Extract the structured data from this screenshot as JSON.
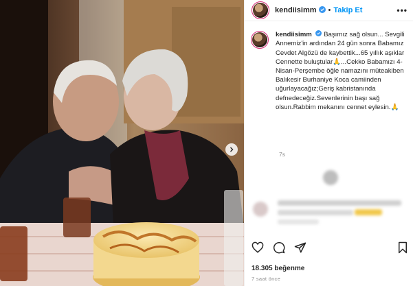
{
  "post": {
    "username": "kendiisimm",
    "follow_label": "Takip Et",
    "more_label": "•••",
    "caption": "Başımız sağ olsun... Sevgili Annemiz'in ardından 24 gün sonra Babamız Cevdet Algözü de kaybettik...65 yıllık aşıklar Cennette buluştular🙏...Cekko Babamızı 4-Nisan-Perşembe öğle namazını müteakiben Balıkesir Burhaniye Koca camiinden uğurlayacağız;Geriş kabristanında defnedeceğiz.Sevenlerinin başı sağ olsun.Rabbim mekanını cennet eylesin.🙏",
    "caption_time": "7s",
    "likes": "18.305 beğenme",
    "posted_ago": "7 saat önce"
  },
  "icons": {
    "verified": "verified-badge-icon",
    "next": "chevron-right-icon",
    "like": "heart-icon",
    "comment": "comment-icon",
    "share": "share-icon",
    "save": "bookmark-icon"
  },
  "colors": {
    "follow": "#0095f6",
    "verified": "#3897f0",
    "text": "#262626",
    "muted": "#8e8e8e"
  }
}
